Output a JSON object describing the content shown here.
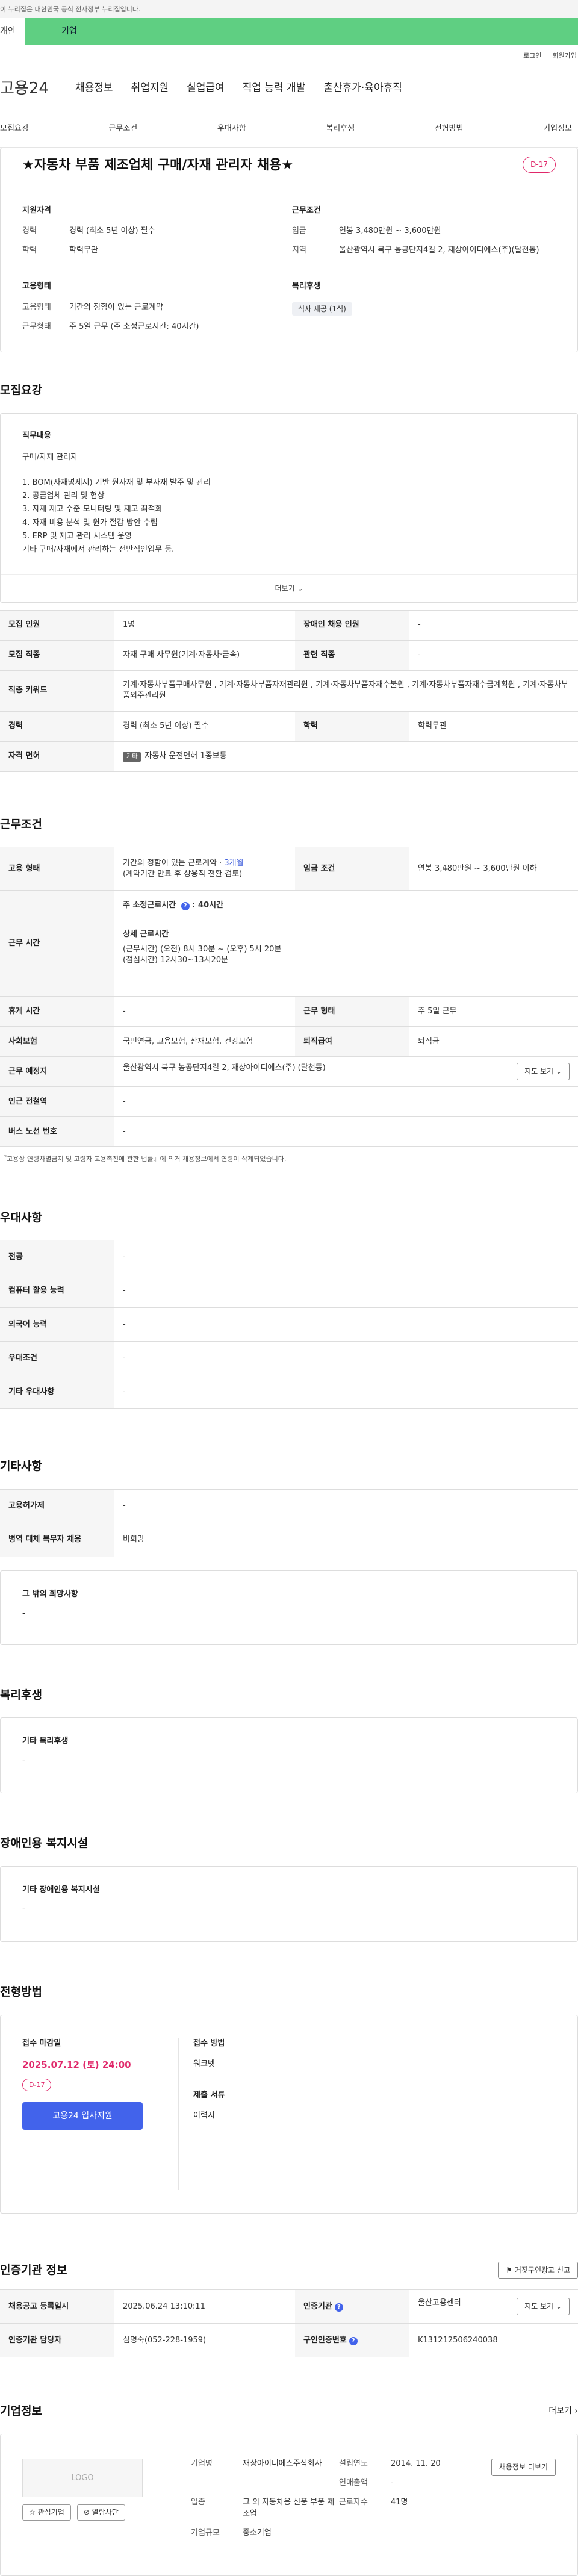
{
  "gov_banner": "이 누리집은 대한민국 공식 전자정부 누리집입니다.",
  "top_tabs": [
    "개인",
    "기업"
  ],
  "util": [
    "로그인",
    "회원가입"
  ],
  "logo": "고용24",
  "gnb": [
    "채용정보",
    "취업지원",
    "실업급여",
    "직업 능력 개발",
    "출산휴가·육아휴직"
  ],
  "lnb": [
    "모집요강",
    "근무조건",
    "우대사항",
    "복리후생",
    "전형방법",
    "기업정보"
  ],
  "summary": {
    "title": "★자동차 부품 제조업체 구매/자재 관리자 채용★",
    "dday": "D-17",
    "qual": {
      "head": "지원자격",
      "career_k": "경력",
      "career_v": "경력 (최소 5년 이상) 필수",
      "edu_k": "학력",
      "edu_v": "학력무관"
    },
    "cond": {
      "head": "근무조건",
      "wage_k": "임금",
      "wage_v": "연봉 3,480만원 ~ 3,600만원",
      "loc_k": "지역",
      "loc_v": "울산광역시 북구 농공단지4길 2, 재상아이디에스(주)(달천동)"
    },
    "emp": {
      "head": "고용형태",
      "type_k": "고용형태",
      "type_v": "기간의 정함이 있는 근로계약",
      "hours_k": "근무형태",
      "hours_v": "주 5일 근무 (주 소정근로시간: 40시간)"
    },
    "welfare": {
      "head": "복리후생",
      "chip": "식사 제공 (1식)"
    }
  },
  "recruit": {
    "title": "모집요강",
    "desc_head": "직무내용",
    "desc_lines": [
      "구매/자재 관리자",
      "",
      "1. BOM(자재명세서) 기반 원자재 및 부자재 발주 및 관리",
      "2. 공급업체 관리 및 협상",
      "3. 자재 재고 수준 모니터링 및 재고 최적화",
      "4. 자재 비용 분석 및 원가 절감 방안 수립",
      "5. ERP 및 재고 관리 시스템 운영",
      "기타 구매/자재에서 관리하는 전반적인업무 등."
    ],
    "more": "더보기",
    "rows": {
      "count_k": "모집 인원",
      "count_v": "1명",
      "dis_k": "장애인 채용 인원",
      "dis_v": "-",
      "job_k": "모집 직종",
      "job_v": "자재 구매 사무원(기계·자동차·금속)",
      "rel_k": "관련 직종",
      "rel_v": "-",
      "kw_k": "직종 키워드",
      "kw_v": "기계·자동차부품구매사무원 , 기계·자동차부품자재관리원 , 기계·자동차부품자재수불원 , 기계·자동차부품자재수급계획원 , 기계·자동차부품외주관리원",
      "car_k": "경력",
      "car_v": "경력 (최소 5년 이상) 필수",
      "edu_k": "학력",
      "edu_v": "학력무관",
      "lic_k": "자격 면허",
      "lic_badge": "기타",
      "lic_v": "자동차 운전면허 1종보통"
    }
  },
  "work": {
    "title": "근무조건",
    "type_k": "고용 형태",
    "type_v1": "기간의 정함이 있는 근로계약 · ",
    "type_v1b": "3개월",
    "type_v2": "(계약기간 만료 후 상용직 전환 검토)",
    "wage_k": "임금 조건",
    "wage_v": "연봉 3,480만원 ~ 3,600만원 이하",
    "time_k": "근무 시간",
    "time_main": "주 소정근로시간",
    "time_main_v": "40시간",
    "time_detail_h": "상세 근로시간",
    "time_detail_1": "(근무시간) (오전) 8시 30분 ~ (오후) 5시 20분",
    "time_detail_2": "(점심시간) 12시30~13시20분",
    "rest_k": "휴게 시간",
    "rest_v": "-",
    "shape_k": "근무 형태",
    "shape_v": "주 5일 근무",
    "ins_k": "사회보험",
    "ins_v": "국민연금, 고용보험, 산재보험, 건강보험",
    "sev_k": "퇴직급여",
    "sev_v": "퇴직금",
    "loc_k": "근무 예정지",
    "loc_v": "울산광역시 북구 농공단지4길 2, 재상아이디에스(주) (달천동)",
    "map_btn": "지도 보기",
    "sub_k": "인근 전철역",
    "sub_v": "-",
    "bus_k": "버스 노선 번호",
    "bus_v": "-",
    "note": "『고용상 연령차별금지 및 고령자 고용촉진에 관한 법률』에 의거 채용정보에서 연령이 삭제되었습니다."
  },
  "prefer": {
    "title": "우대사항",
    "rows": [
      {
        "k": "전공",
        "v": "-"
      },
      {
        "k": "컴퓨터 활용 능력",
        "v": "-"
      },
      {
        "k": "외국어 능력",
        "v": "-"
      },
      {
        "k": "우대조건",
        "v": "-"
      },
      {
        "k": "기타 우대사항",
        "v": "-"
      }
    ]
  },
  "etc": {
    "title": "기타사항",
    "rows": [
      {
        "k": "고용허가제",
        "v": "-"
      },
      {
        "k": "병역 대체 복무자 채용",
        "v": "비희망"
      }
    ],
    "other_h": "그 밖의 희망사항",
    "other_v": "-"
  },
  "benefit": {
    "title": "복리후생",
    "h": "기타 복리후생",
    "v": "-"
  },
  "disabled": {
    "title": "장애인용 복지시설",
    "h": "기타 장애인용 복지시설",
    "v": "-"
  },
  "screen": {
    "title": "전형방법",
    "deadline_h": "접수 마감일",
    "deadline_v": "2025.07.12 (토) 24:00",
    "dday": "D-17",
    "apply_btn": "고용24 입사지원",
    "method_h": "접수 방법",
    "method_v": "워크넷",
    "docs_h": "제출 서류",
    "docs_v": "이력서"
  },
  "auth": {
    "title": "인증기관 정보",
    "report_btn": "거짓구인광고 신고",
    "reg_k": "채용공고 등록일시",
    "reg_v": "2025.06.24 13:10:11",
    "org_k": "인증기관",
    "org_v": "울산고용센터",
    "map_btn": "지도 보기",
    "mgr_k": "인증기관 담당자",
    "mgr_v": "심명숙(052-228-1959)",
    "no_k": "구인인증번호",
    "no_v": "K131212506240038"
  },
  "company": {
    "title": "기업정보",
    "more": "더보기",
    "logo": "LOGO",
    "fav_btn": "관심기업",
    "block_btn": "열람차단",
    "info_btn": "채용정보 더보기",
    "name_k": "기업명",
    "name_v": "재상아이디에스주식회사",
    "year_k": "설립연도",
    "year_v": "2014. 11. 20",
    "sales_k": "연매출액",
    "sales_v": "-",
    "ind_k": "업종",
    "ind_v": "그 외 자동차용 신품 부품 제조업",
    "emp_k": "근로자수",
    "emp_v": "41명",
    "size_k": "기업규모",
    "size_v": "중소기업"
  }
}
